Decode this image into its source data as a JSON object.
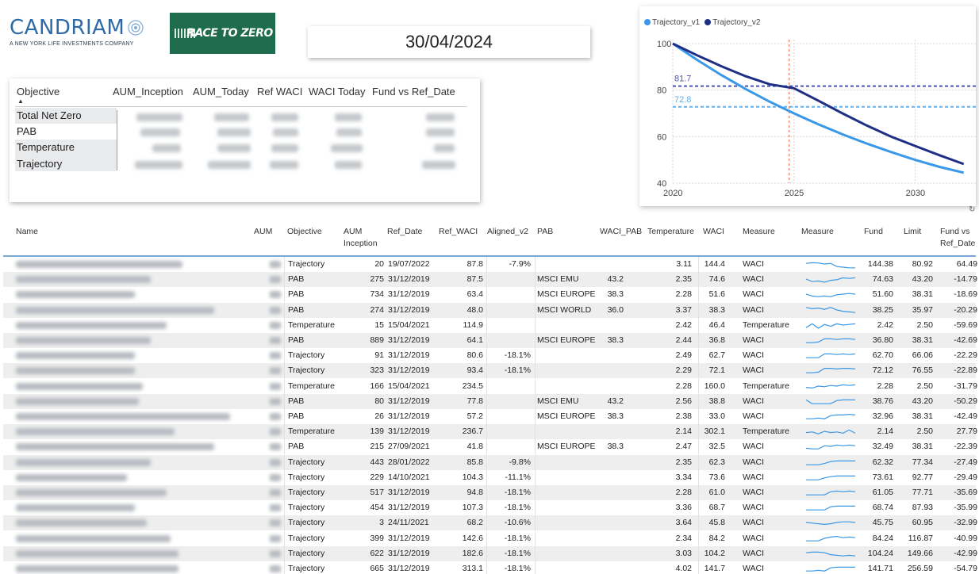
{
  "header": {
    "logo_name": "CANDRIAM",
    "logo_tagline": "A NEW YORK LIFE INVESTMENTS COMPANY",
    "badge": "RACE TO ZERO",
    "date": "30/04/2024"
  },
  "summary": {
    "headers": [
      "Objective",
      "AUM_Inception",
      "AUM_Today",
      "Ref WACI",
      "WACI Today",
      "Fund vs Ref_Date"
    ],
    "rows": [
      "Total Net Zero",
      "PAB",
      "Temperature",
      "Trajectory"
    ]
  },
  "chart_data": {
    "type": "line",
    "x": [
      2020,
      2021,
      2022,
      2023,
      2024,
      2025,
      2026,
      2027,
      2028,
      2029,
      2030,
      2031,
      2032
    ],
    "series": [
      {
        "name": "Trajectory_v1",
        "color": "#3a98e8",
        "values": [
          100,
          93,
          86.5,
          80.5,
          75,
          70,
          65.3,
          61,
          57,
          53.4,
          50,
          47,
          44.5
        ]
      },
      {
        "name": "Trajectory_v2",
        "color": "#1f2f86",
        "values": [
          100,
          95,
          90.3,
          86,
          82.5,
          80.8,
          75.5,
          70,
          64.8,
          60,
          56,
          52,
          48.2
        ]
      }
    ],
    "reference_lines": [
      {
        "label": "81.7",
        "value": 81.7,
        "color": "#4a55b5"
      },
      {
        "label": "72.8",
        "value": 72.8,
        "color": "#5fb0f0"
      }
    ],
    "vertical_marker": {
      "x": 2024.8,
      "color": "#f08a6a"
    },
    "ylim": [
      40,
      100
    ],
    "yticks": [
      "100",
      "80",
      "60",
      "40"
    ],
    "xticks": [
      "2020",
      "2025",
      "2030"
    ],
    "legend_position": "top-left",
    "grid": true
  },
  "table": {
    "columns": [
      "Name",
      "AUM",
      "Objective",
      "AUM Inception",
      "Ref_Date",
      "Ref_WACI",
      "Aligned_v2",
      "PAB",
      "WACI_PAB",
      "Temperature",
      "WACI",
      "Measure",
      "Measure",
      "Fund",
      "Limit",
      "Fund vs Ref_Date"
    ],
    "rows": [
      {
        "objective": "Trajectory",
        "aum_inception": "20",
        "ref_date": "19/07/2022",
        "ref_waci": "87.8",
        "aligned": "-7.9%",
        "pab": "",
        "waci_pab": "",
        "temperature": "3.11",
        "waci": "144.4",
        "measure": "WACI",
        "fund": "144.38",
        "limit": "80.92",
        "fvr": "64.49",
        "spark": [
          0.55,
          0.6,
          0.58,
          0.5,
          0.55,
          0.3,
          0.25,
          0.2,
          0.2
        ]
      },
      {
        "objective": "PAB",
        "aum_inception": "275",
        "ref_date": "31/12/2019",
        "ref_waci": "87.5",
        "aligned": "",
        "pab": "MSCI EMU",
        "waci_pab": "43.2",
        "temperature": "2.35",
        "waci": "74.6",
        "measure": "WACI",
        "fund": "74.63",
        "limit": "43.20",
        "fvr": "-14.79",
        "spark": [
          0.5,
          0.3,
          0.35,
          0.25,
          0.4,
          0.45,
          0.6,
          0.55,
          0.6
        ]
      },
      {
        "objective": "PAB",
        "aum_inception": "734",
        "ref_date": "31/12/2019",
        "ref_waci": "63.4",
        "aligned": "",
        "pab": "MSCI EUROPE",
        "waci_pab": "38.3",
        "temperature": "2.28",
        "waci": "51.6",
        "measure": "WACI",
        "fund": "51.60",
        "limit": "38.31",
        "fvr": "-18.69",
        "spark": [
          0.5,
          0.35,
          0.3,
          0.35,
          0.3,
          0.45,
          0.5,
          0.55,
          0.5
        ]
      },
      {
        "objective": "PAB",
        "aum_inception": "274",
        "ref_date": "31/12/2019",
        "ref_waci": "48.0",
        "aligned": "",
        "pab": "MSCI WORLD",
        "waci_pab": "36.0",
        "temperature": "3.37",
        "waci": "38.3",
        "measure": "WACI",
        "fund": "38.25",
        "limit": "35.97",
        "fvr": "-20.29",
        "spark": [
          0.7,
          0.6,
          0.65,
          0.55,
          0.7,
          0.5,
          0.4,
          0.35,
          0.3
        ]
      },
      {
        "objective": "Temperature",
        "aum_inception": "15",
        "ref_date": "15/04/2021",
        "ref_waci": "114.9",
        "aligned": "",
        "pab": "",
        "waci_pab": "",
        "temperature": "2.42",
        "waci": "46.4",
        "measure": "Temperature",
        "fund": "2.42",
        "limit": "2.50",
        "fvr": "-59.69",
        "spark": [
          0.3,
          0.6,
          0.25,
          0.55,
          0.4,
          0.6,
          0.5,
          0.55,
          0.6
        ]
      },
      {
        "objective": "PAB",
        "aum_inception": "889",
        "ref_date": "31/12/2019",
        "ref_waci": "64.1",
        "aligned": "",
        "pab": "MSCI EUROPE",
        "waci_pab": "38.3",
        "temperature": "2.44",
        "waci": "36.8",
        "measure": "WACI",
        "fund": "36.80",
        "limit": "38.31",
        "fvr": "-42.69",
        "spark": [
          0.3,
          0.3,
          0.35,
          0.6,
          0.6,
          0.55,
          0.6,
          0.6,
          0.55
        ]
      },
      {
        "objective": "Trajectory",
        "aum_inception": "91",
        "ref_date": "31/12/2019",
        "ref_waci": "80.6",
        "aligned": "-18.1%",
        "pab": "",
        "waci_pab": "",
        "temperature": "2.49",
        "waci": "62.7",
        "measure": "WACI",
        "fund": "62.70",
        "limit": "66.06",
        "fvr": "-22.29",
        "spark": [
          0.3,
          0.3,
          0.3,
          0.6,
          0.6,
          0.55,
          0.6,
          0.55,
          0.6
        ]
      },
      {
        "objective": "Trajectory",
        "aum_inception": "323",
        "ref_date": "31/12/2019",
        "ref_waci": "93.4",
        "aligned": "-18.1%",
        "pab": "",
        "waci_pab": "",
        "temperature": "2.29",
        "waci": "72.1",
        "measure": "WACI",
        "fund": "72.12",
        "limit": "76.55",
        "fvr": "-22.89",
        "spark": [
          0.3,
          0.3,
          0.35,
          0.65,
          0.65,
          0.6,
          0.65,
          0.65,
          0.6
        ]
      },
      {
        "objective": "Temperature",
        "aum_inception": "166",
        "ref_date": "15/04/2021",
        "ref_waci": "234.5",
        "aligned": "",
        "pab": "",
        "waci_pab": "",
        "temperature": "2.28",
        "waci": "160.0",
        "measure": "Temperature",
        "fund": "2.28",
        "limit": "2.50",
        "fvr": "-31.79",
        "spark": [
          0.4,
          0.35,
          0.5,
          0.45,
          0.55,
          0.5,
          0.6,
          0.55,
          0.6
        ]
      },
      {
        "objective": "PAB",
        "aum_inception": "80",
        "ref_date": "31/12/2019",
        "ref_waci": "77.8",
        "aligned": "",
        "pab": "MSCI EMU",
        "waci_pab": "43.2",
        "temperature": "2.56",
        "waci": "38.8",
        "measure": "WACI",
        "fund": "38.76",
        "limit": "43.20",
        "fvr": "-50.29",
        "spark": [
          0.6,
          0.3,
          0.3,
          0.3,
          0.3,
          0.55,
          0.6,
          0.6,
          0.6
        ]
      },
      {
        "objective": "PAB",
        "aum_inception": "26",
        "ref_date": "31/12/2019",
        "ref_waci": "57.2",
        "aligned": "",
        "pab": "MSCI EUROPE",
        "waci_pab": "38.3",
        "temperature": "2.38",
        "waci": "33.0",
        "measure": "WACI",
        "fund": "32.96",
        "limit": "38.31",
        "fvr": "-42.49",
        "spark": [
          0.3,
          0.3,
          0.35,
          0.3,
          0.55,
          0.6,
          0.6,
          0.65,
          0.6
        ]
      },
      {
        "objective": "Temperature",
        "aum_inception": "139",
        "ref_date": "31/12/2019",
        "ref_waci": "236.7",
        "aligned": "",
        "pab": "",
        "waci_pab": "",
        "temperature": "2.14",
        "waci": "302.1",
        "measure": "Temperature",
        "fund": "2.14",
        "limit": "2.50",
        "fvr": "27.79",
        "spark": [
          0.4,
          0.45,
          0.3,
          0.5,
          0.4,
          0.45,
          0.35,
          0.6,
          0.35
        ]
      },
      {
        "objective": "PAB",
        "aum_inception": "215",
        "ref_date": "27/09/2021",
        "ref_waci": "41.8",
        "aligned": "",
        "pab": "MSCI EUROPE",
        "waci_pab": "38.3",
        "temperature": "2.47",
        "waci": "32.5",
        "measure": "WACI",
        "fund": "32.49",
        "limit": "38.31",
        "fvr": "-22.39",
        "spark": [
          0.35,
          0.3,
          0.3,
          0.55,
          0.5,
          0.6,
          0.55,
          0.6,
          0.55
        ]
      },
      {
        "objective": "Trajectory",
        "aum_inception": "443",
        "ref_date": "28/01/2022",
        "ref_waci": "85.8",
        "aligned": "-9.8%",
        "pab": "",
        "waci_pab": "",
        "temperature": "2.35",
        "waci": "62.3",
        "measure": "WACI",
        "fund": "62.32",
        "limit": "77.34",
        "fvr": "-27.49",
        "spark": [
          0.3,
          0.3,
          0.3,
          0.4,
          0.55,
          0.6,
          0.6,
          0.6,
          0.6
        ]
      },
      {
        "objective": "Trajectory",
        "aum_inception": "229",
        "ref_date": "14/10/2021",
        "ref_waci": "104.3",
        "aligned": "-11.1%",
        "pab": "",
        "waci_pab": "",
        "temperature": "3.34",
        "waci": "73.6",
        "measure": "WACI",
        "fund": "73.61",
        "limit": "92.77",
        "fvr": "-29.49",
        "spark": [
          0.3,
          0.3,
          0.3,
          0.45,
          0.55,
          0.6,
          0.6,
          0.6,
          0.6
        ]
      },
      {
        "objective": "Trajectory",
        "aum_inception": "517",
        "ref_date": "31/12/2019",
        "ref_waci": "94.8",
        "aligned": "-18.1%",
        "pab": "",
        "waci_pab": "",
        "temperature": "2.28",
        "waci": "61.0",
        "measure": "WACI",
        "fund": "61.05",
        "limit": "77.71",
        "fvr": "-35.69",
        "spark": [
          0.3,
          0.3,
          0.3,
          0.3,
          0.55,
          0.6,
          0.55,
          0.6,
          0.55
        ]
      },
      {
        "objective": "Trajectory",
        "aum_inception": "454",
        "ref_date": "31/12/2019",
        "ref_waci": "107.3",
        "aligned": "-18.1%",
        "pab": "",
        "waci_pab": "",
        "temperature": "3.36",
        "waci": "68.7",
        "measure": "WACI",
        "fund": "68.74",
        "limit": "87.93",
        "fvr": "-35.99",
        "spark": [
          0.3,
          0.3,
          0.3,
          0.3,
          0.55,
          0.6,
          0.6,
          0.6,
          0.6
        ]
      },
      {
        "objective": "Trajectory",
        "aum_inception": "3",
        "ref_date": "24/11/2021",
        "ref_waci": "68.2",
        "aligned": "-10.6%",
        "pab": "",
        "waci_pab": "",
        "temperature": "3.64",
        "waci": "45.8",
        "measure": "WACI",
        "fund": "45.75",
        "limit": "60.95",
        "fvr": "-32.99",
        "spark": [
          0.5,
          0.45,
          0.4,
          0.35,
          0.4,
          0.5,
          0.55,
          0.55,
          0.5
        ]
      },
      {
        "objective": "Trajectory",
        "aum_inception": "399",
        "ref_date": "31/12/2019",
        "ref_waci": "142.6",
        "aligned": "-18.1%",
        "pab": "",
        "waci_pab": "",
        "temperature": "2.34",
        "waci": "84.2",
        "measure": "WACI",
        "fund": "84.24",
        "limit": "116.87",
        "fvr": "-40.99",
        "spark": [
          0.3,
          0.3,
          0.3,
          0.5,
          0.6,
          0.65,
          0.55,
          0.6,
          0.55
        ]
      },
      {
        "objective": "Trajectory",
        "aum_inception": "622",
        "ref_date": "31/12/2019",
        "ref_waci": "182.6",
        "aligned": "-18.1%",
        "pab": "",
        "waci_pab": "",
        "temperature": "3.03",
        "waci": "104.2",
        "measure": "WACI",
        "fund": "104.24",
        "limit": "149.66",
        "fvr": "-42.99",
        "spark": [
          0.55,
          0.6,
          0.6,
          0.55,
          0.4,
          0.35,
          0.3,
          0.35,
          0.3
        ]
      },
      {
        "objective": "Trajectory",
        "aum_inception": "665",
        "ref_date": "31/12/2019",
        "ref_waci": "313.1",
        "aligned": "-18.1%",
        "pab": "",
        "waci_pab": "",
        "temperature": "4.02",
        "waci": "141.7",
        "measure": "WACI",
        "fund": "141.71",
        "limit": "256.59",
        "fvr": "-54.79",
        "spark": [
          0.3,
          0.3,
          0.35,
          0.3,
          0.55,
          0.6,
          0.6,
          0.6,
          0.6
        ]
      }
    ]
  }
}
